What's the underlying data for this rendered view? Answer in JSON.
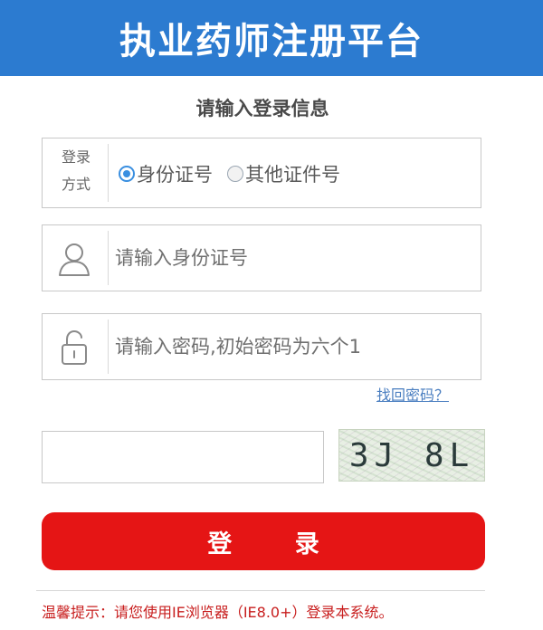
{
  "header": {
    "title": "执业药师注册平台"
  },
  "form": {
    "subtitle": "请输入登录信息",
    "login_mode": {
      "label_line1": "登录",
      "label_line2": "方式",
      "options": [
        {
          "label": "身份证号",
          "checked": true
        },
        {
          "label": "其他证件号",
          "checked": false
        }
      ]
    },
    "id_field": {
      "placeholder": "请输入身份证号",
      "icon": "user-icon"
    },
    "password_field": {
      "placeholder": "请输入密码,初始密码为六个1",
      "icon": "lock-icon"
    },
    "forgot_password": "找回密码？",
    "captcha": {
      "value": "",
      "text": "3J 8L"
    },
    "login_button": "登 录",
    "tip": "温馨提示：请您使用IE浏览器（IE8.0+）登录本系统。"
  },
  "colors": {
    "banner": "#2c7bd0",
    "button": "#e51515",
    "tip": "#c81e1e",
    "link": "#4a7ec0"
  }
}
